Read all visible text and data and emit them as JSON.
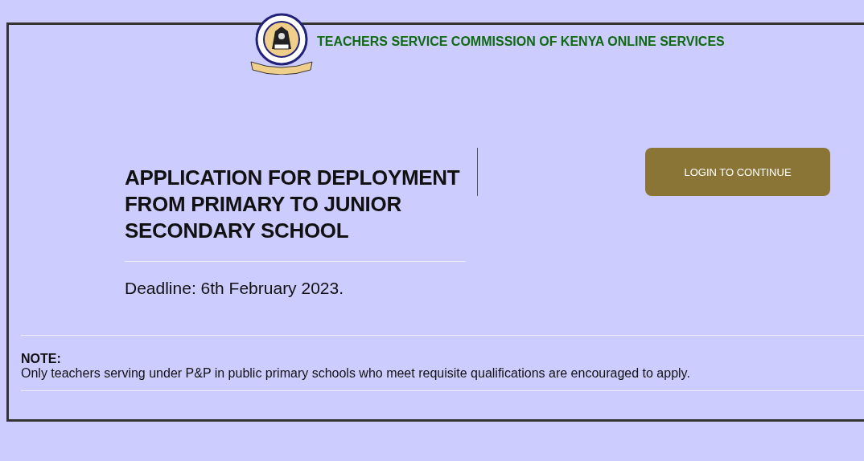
{
  "header": {
    "title": "TEACHERS SERVICE COMMISSION OF KENYA ONLINE SERVICES"
  },
  "main": {
    "heading": "APPLICATION FOR DEPLOYMENT FROM PRIMARY TO JUNIOR SECONDARY SCHOOL",
    "deadline": "Deadline: 6th February 2023.",
    "button": "LOGIN TO CONTINUE"
  },
  "note": {
    "label": "NOTE:",
    "text": "Only teachers serving under P&P in public primary schools who meet requisite qualifications are encouraged to apply."
  }
}
